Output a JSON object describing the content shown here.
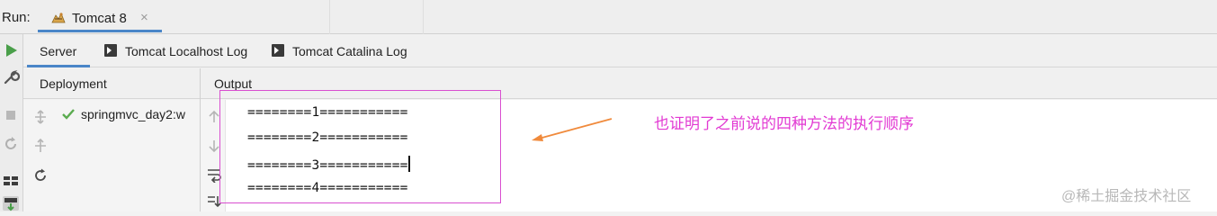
{
  "run_bar": {
    "label": "Run:",
    "tab": {
      "label": "Tomcat 8",
      "close": "×"
    }
  },
  "sub_tabs": [
    {
      "label": "Server",
      "active": true
    },
    {
      "label": "Tomcat Localhost Log",
      "active": false
    },
    {
      "label": "Tomcat Catalina Log",
      "active": false
    }
  ],
  "deployment": {
    "header": "Deployment",
    "items": [
      {
        "label": "springmvc_day2:w",
        "status": "deployed"
      }
    ]
  },
  "output": {
    "header": "Output",
    "lines": [
      "========1===========",
      "========2===========",
      "========3===========",
      "========4==========="
    ]
  },
  "annotation": {
    "text": "也证明了之前说的四种方法的执行顺序",
    "color": "#e23ad3"
  },
  "watermark": "@稀土掘金技术社区",
  "colors": {
    "accent": "#4a86c8",
    "run_green": "#4a9f4a",
    "check_green": "#5aab4f",
    "highlight": "#d94fd0",
    "arrow": "#f08a3c"
  },
  "icons": {
    "left_toolbar": [
      "run-icon",
      "wrench-icon",
      "stop-icon",
      "rerun-icon",
      "layout-icon",
      "deploy-icon"
    ],
    "deploy_toolbar": [
      "deploy-all-icon",
      "undeploy-icon",
      "refresh-icon"
    ],
    "output_gutter": [
      "scroll-up-icon",
      "scroll-down-icon",
      "soft-wrap-icon",
      "scroll-to-end-icon"
    ]
  }
}
